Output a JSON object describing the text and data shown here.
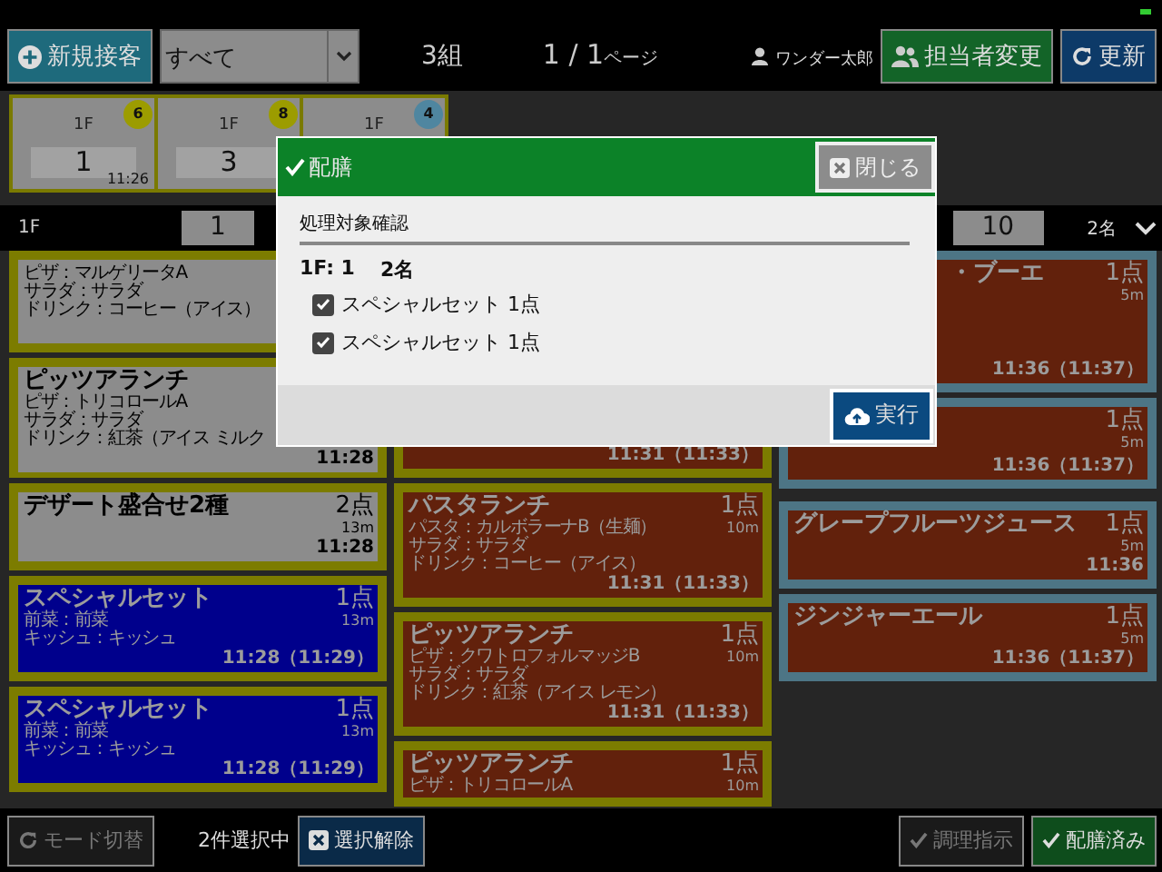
{
  "topbar": {
    "new_button": "新規接客",
    "filter": {
      "value": "すべて"
    },
    "groups": "3組",
    "page": "1 / 1",
    "page_suffix": "ページ",
    "user": "ワンダー太郎",
    "assign_button": "担当者変更",
    "refresh_button": "更新"
  },
  "tables": [
    {
      "floor": "1F",
      "number": "1",
      "time": "11:26",
      "badge": "6",
      "color": "#9c9c00"
    },
    {
      "floor": "1F",
      "number": "3",
      "badge": "8",
      "color": "#9c9c00"
    },
    {
      "floor": "1F",
      "badge": "4",
      "color": "#4f86a0"
    }
  ],
  "columns": [
    {
      "color": "#7c7c00",
      "floor": "1F",
      "table": "1",
      "cards": [
        {
          "color": "#8c8c8c",
          "details": [
            "ピザ：マルゲリータA",
            "サラダ：サラダ",
            "ドリンク：コーヒー（アイス）"
          ]
        },
        {
          "color": "#8c8c8c",
          "title": "ピッツアランチ",
          "details": [
            "ピザ：トリコロールA",
            "サラダ：サラダ",
            "ドリンク：紅茶（アイス ミルク"
          ],
          "time": "11:28"
        },
        {
          "color": "#8c8c8c",
          "title": "デザート盛合せ2種",
          "qty": "2点",
          "minutes": "13m",
          "time": "11:28"
        },
        {
          "color": "#00008c",
          "title": "スペシャルセット",
          "qty": "1点",
          "minutes": "13m",
          "details": [
            "前菜：前菜",
            "キッシュ：キッシュ"
          ],
          "time": "11:28（11:29）"
        },
        {
          "color": "#00008c",
          "title": "スペシャルセット",
          "qty": "1点",
          "minutes": "13m",
          "details": [
            "前菜：前菜",
            "キッシュ：キッシュ"
          ],
          "time": "11:28（11:29）"
        }
      ]
    },
    {
      "color": "#7c7c00",
      "cards": [
        {
          "color": "#62210c",
          "time": "11:31（11:33）"
        },
        {
          "color": "#62210c",
          "title": "パスタランチ",
          "qty": "1点",
          "minutes": "10m",
          "details": [
            "パスタ：カルボラーナB（生麺）",
            "サラダ：サラダ",
            "ドリンク：コーヒー（アイス）"
          ],
          "time": "11:31（11:33）"
        },
        {
          "color": "#62210c",
          "title": "ピッツアランチ",
          "qty": "1点",
          "minutes": "10m",
          "details": [
            "ピザ：クワトロフォルマッジB",
            "サラダ：サラダ",
            "ドリンク：紅茶（アイス レモン）"
          ],
          "time": "11:31（11:33）"
        },
        {
          "color": "#62210c",
          "title": "ピッツアランチ",
          "qty": "1点",
          "minutes": "10m",
          "details": [
            "ピザ：トリコロールA"
          ]
        }
      ]
    },
    {
      "color": "#4d7585",
      "table": "10",
      "guests": "2名",
      "cards": [
        {
          "color": "#62210c",
          "title": "・ブーエ",
          "qty": "1点",
          "minutes": "5m",
          "time": "11:36（11:37）"
        },
        {
          "color": "#62210c",
          "qty": "1点",
          "minutes": "5m",
          "time": "11:36（11:37）"
        },
        {
          "color": "#62210c",
          "title": "グレープフルーツジュース",
          "qty": "1点",
          "minutes": "5m",
          "time": "11:36"
        },
        {
          "color": "#62210c",
          "title": "ジンジャーエール",
          "qty": "1点",
          "minutes": "5m",
          "time": "11:36（11:37）"
        }
      ]
    }
  ],
  "modal": {
    "title": "配膳",
    "close_button": "閉じる",
    "heading": "処理対象確認",
    "table": "1F: 1",
    "guests": "2名",
    "items": [
      {
        "label": "スペシャルセット 1点",
        "checked": true
      },
      {
        "label": "スペシャルセット 1点",
        "checked": true
      }
    ],
    "run_button": "実行"
  },
  "bottombar": {
    "mode_button": {
      "label": "モード切替",
      "disabled": true
    },
    "selection": "2件選択中",
    "clear_button": "選択解除",
    "cook_button": {
      "label": "調理指示",
      "disabled": true
    },
    "served_button": {
      "label": "配膳済み",
      "disabled": false
    }
  }
}
